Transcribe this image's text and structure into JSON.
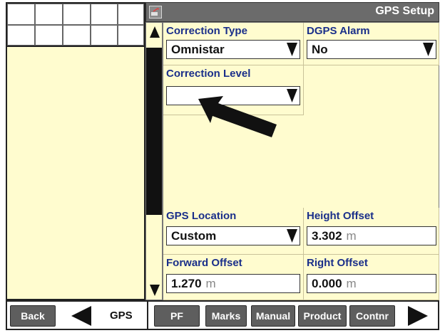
{
  "window": {
    "title": "GPS Setup"
  },
  "fields": {
    "correction_type": {
      "label": "Correction Type",
      "value": "Omnistar"
    },
    "dgps_alarm": {
      "label": "DGPS Alarm",
      "value": "No"
    },
    "correction_level": {
      "label": "Correction Level",
      "value": ""
    },
    "gps_location": {
      "label": "GPS Location",
      "value": "Custom"
    },
    "height_offset": {
      "label": "Height Offset",
      "value": "3.302",
      "unit": "m"
    },
    "forward_offset": {
      "label": "Forward Offset",
      "value": "1.270",
      "unit": "m"
    },
    "right_offset": {
      "label": "Right Offset",
      "value": "0.000",
      "unit": "m"
    }
  },
  "bottom_bar": {
    "back_label": "Back",
    "page_label": "GPS",
    "tabs": [
      "PF",
      "Marks",
      "Manual",
      "Product",
      "Contnr"
    ]
  },
  "colors": {
    "panel_bg": "#fffccf",
    "label_blue": "#1a2f8a",
    "button_gray": "#5e5e5e",
    "title_bar": "#6b6b6b"
  },
  "icons": {
    "scroll_up": "triangle-up-icon",
    "scroll_down": "triangle-down-icon",
    "dropdown": "dropdown-icon",
    "prev": "triangle-left-icon",
    "next": "triangle-right-icon",
    "pointer_arrow": "pointer-arrow-icon"
  }
}
